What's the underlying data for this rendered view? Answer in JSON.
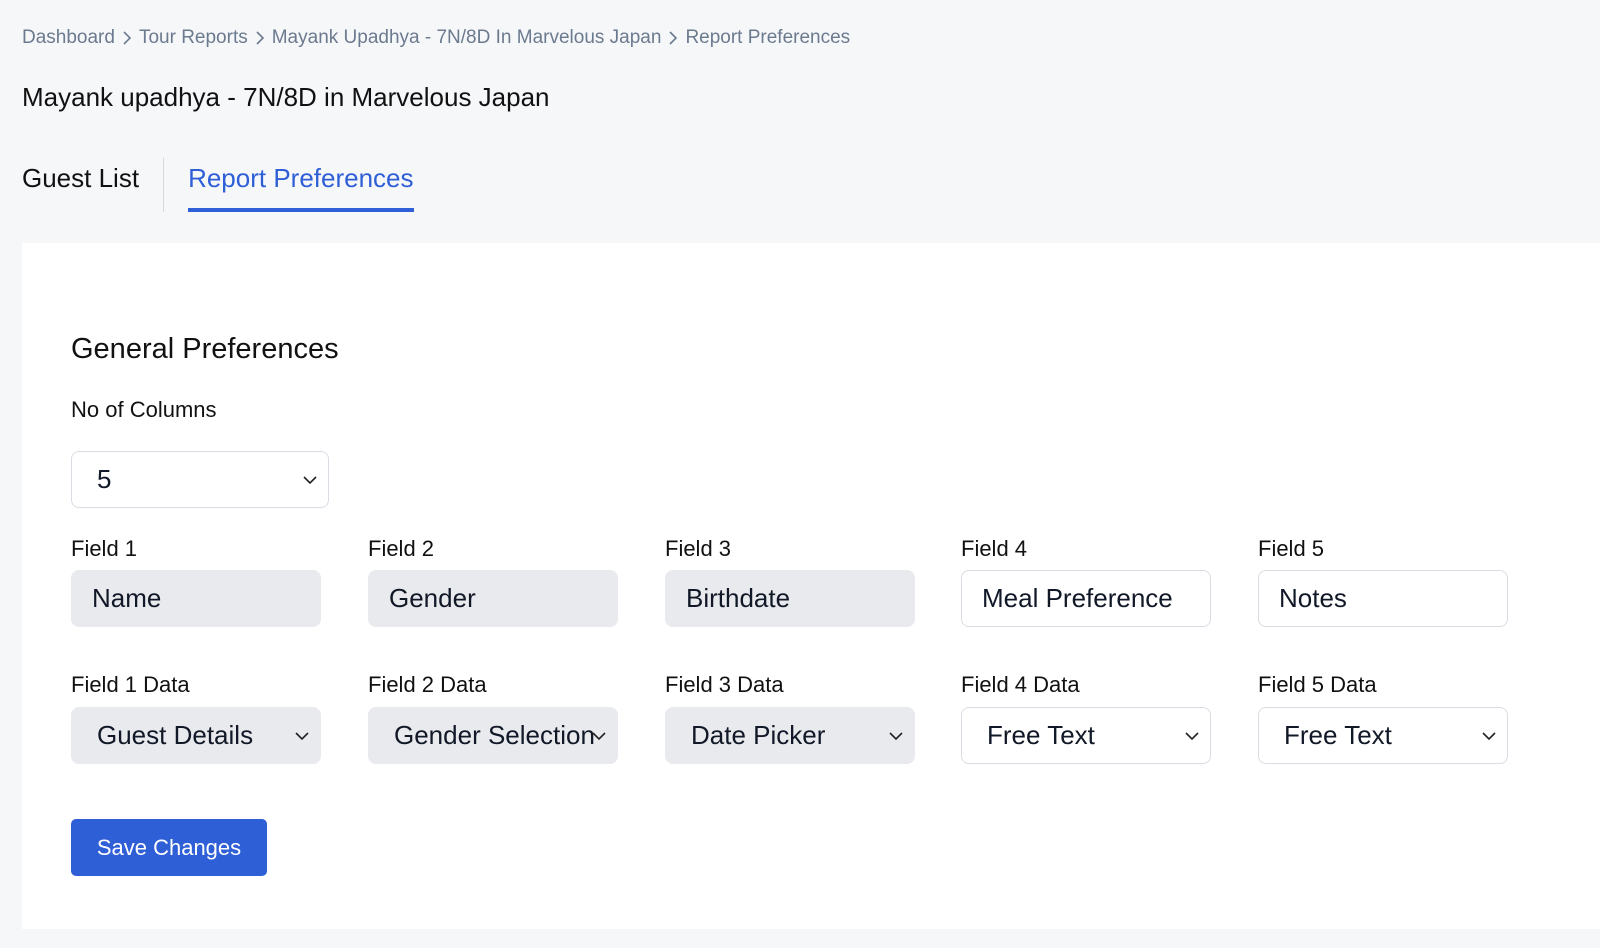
{
  "breadcrumb": {
    "items": [
      "Dashboard",
      "Tour Reports",
      "Mayank Upadhya - 7N/8D In Marvelous Japan",
      "Report Preferences"
    ],
    "separator_icon": "chevron-right-icon"
  },
  "page": {
    "title": "Mayank upadhya - 7N/8D in Marvelous Japan"
  },
  "tabs": [
    {
      "label": "Guest List",
      "active": false
    },
    {
      "label": "Report Preferences",
      "active": true
    }
  ],
  "general": {
    "title": "General Preferences",
    "columns_label": "No of Columns",
    "columns_value": "5"
  },
  "fields": [
    {
      "label": "Field 1",
      "value": "Name",
      "data_label": "Field 1 Data",
      "data_value": "Guest Details",
      "editable": false
    },
    {
      "label": "Field 2",
      "value": "Gender",
      "data_label": "Field 2 Data",
      "data_value": "Gender Selection",
      "editable": false
    },
    {
      "label": "Field 3",
      "value": "Birthdate",
      "data_label": "Field 3 Data",
      "data_value": "Date Picker",
      "editable": false
    },
    {
      "label": "Field 4",
      "value": "Meal Preference",
      "data_label": "Field 4 Data",
      "data_value": "Free Text",
      "editable": true
    },
    {
      "label": "Field 5",
      "value": "Notes",
      "data_label": "Field 5 Data",
      "data_value": "Free Text",
      "editable": true
    }
  ],
  "actions": {
    "save_label": "Save Changes"
  },
  "colors": {
    "accent": "#2f5fd6",
    "background": "#f6f7f9",
    "disabled_field": "#e9eaed",
    "breadcrumb_text": "#6b7a8f"
  }
}
